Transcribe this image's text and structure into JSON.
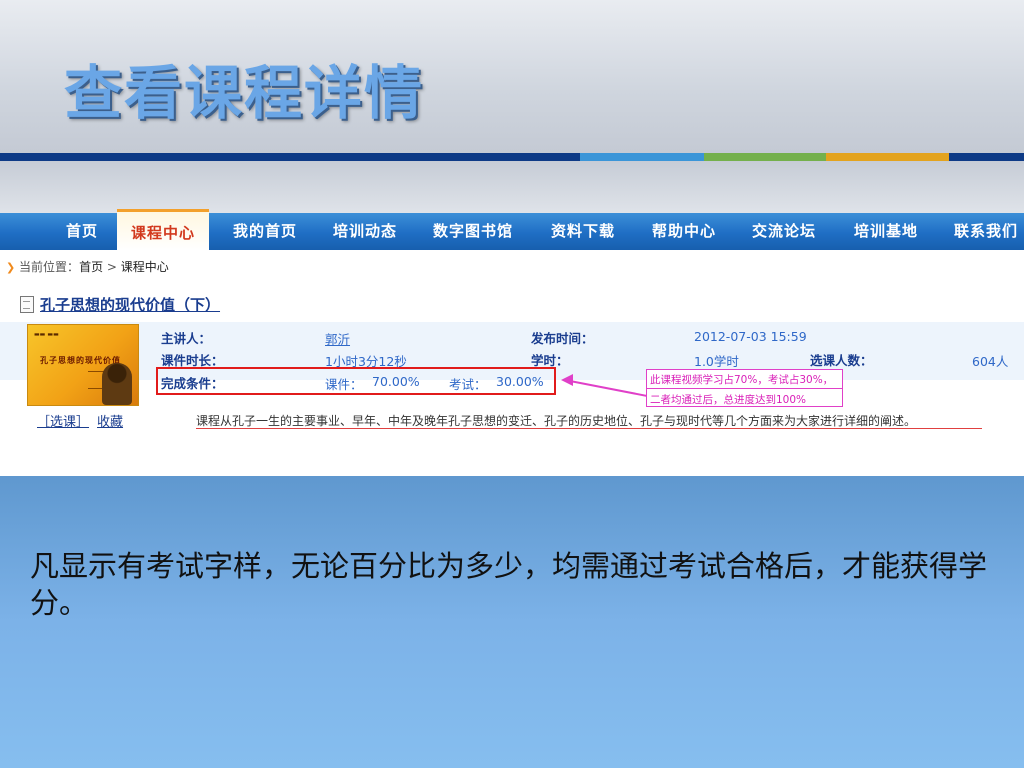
{
  "slide": {
    "title": "查看课程详情",
    "body_text": "凡显示有考试字样，无论百分比为多少，均需通过考试合格后，才能获得学分。"
  },
  "nav": {
    "items": [
      {
        "label": "首页"
      },
      {
        "label": "课程中心",
        "active": true
      },
      {
        "label": "我的首页"
      },
      {
        "label": "培训动态"
      },
      {
        "label": "数字图书馆"
      },
      {
        "label": "资料下载"
      },
      {
        "label": "帮助中心"
      },
      {
        "label": "交流论坛"
      },
      {
        "label": "培训基地"
      },
      {
        "label": "联系我们"
      }
    ]
  },
  "breadcrumb": {
    "prefix": "当前位置：",
    "home": "首页",
    "separator": ">",
    "current": "课程中心"
  },
  "course": {
    "title": "孔子思想的现代价值（下）",
    "thumbnail_title": "孔子思想的现代价值",
    "actions": {
      "enroll": "［选课］",
      "favorite": "收藏"
    },
    "speaker_label": "主讲人：",
    "speaker": "郭沂",
    "publish_label": "发布时间：",
    "publish_time": "2012-07-03 15:59",
    "duration_label": "课件时长：",
    "duration": "1小时3分12秒",
    "hours_label": "学时：",
    "hours": "1.0学时",
    "enrolled_label": "选课人数：",
    "enrolled": "604人",
    "completion_label": "完成条件：",
    "courseware_label": "课件：",
    "courseware_pct": "70.00%",
    "exam_label": "考试：",
    "exam_pct": "30.00%",
    "description": "课程从孔子一生的主要事业、早年、中年及晚年孔子思想的变迁、孔子的历史地位、孔子与现时代等几个方面来为大家进行详细的阐述。"
  },
  "annotation": {
    "line1": "此课程视频学习占70%，考试占30%，",
    "line2": "二者均通过后，总进度达到100%"
  },
  "colors": {
    "title_blue": "#6aa6e6",
    "nav_blue": "#1f6ec4",
    "active_tab_text": "#d2391e",
    "highlight_red": "#e11b1b",
    "annotation_magenta": "#d91fb8"
  }
}
